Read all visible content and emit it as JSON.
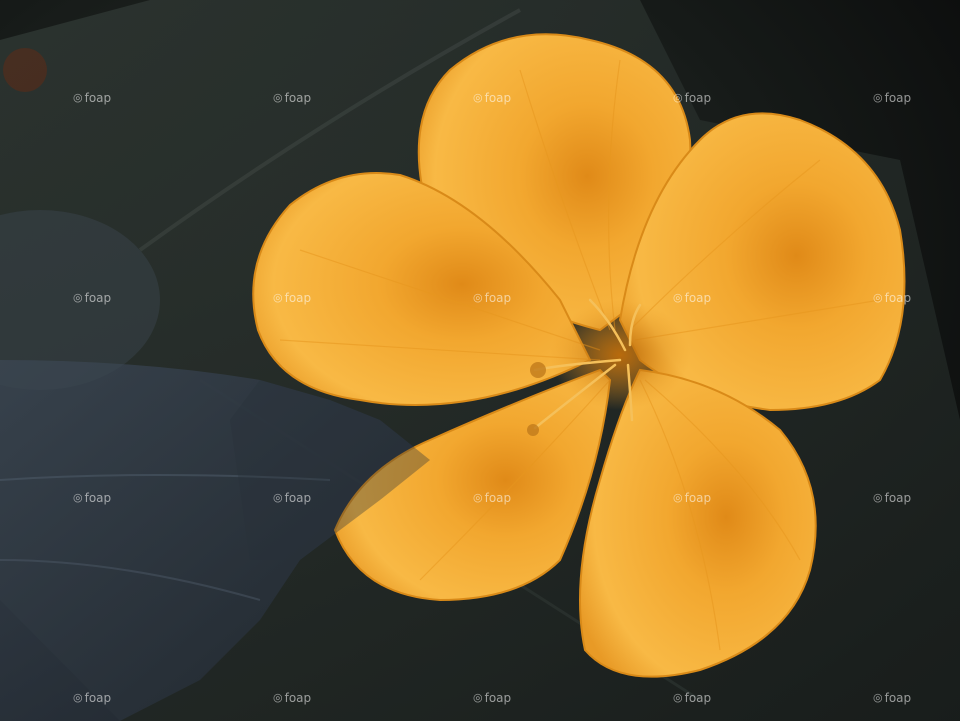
{
  "photo": {
    "subject": "orange-flower",
    "colors": {
      "petal_light": "#F7B43C",
      "petal_mid": "#EFA129",
      "petal_dark": "#C87912",
      "leaf_dark": "#1E2522",
      "leaf_shadow": "#27303A",
      "background": "#101211"
    }
  },
  "watermark": {
    "icon": "camera-lens-icon",
    "text": "foap",
    "glyph": "◎"
  }
}
